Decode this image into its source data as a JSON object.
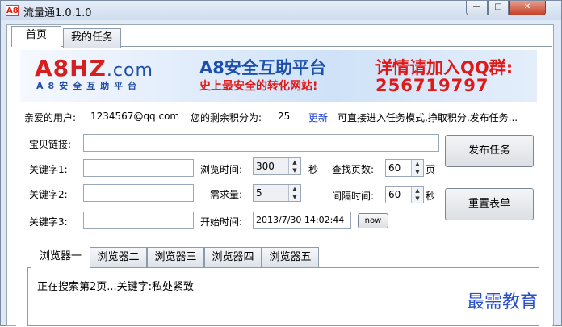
{
  "window": {
    "title": "流量通1.0.1.0",
    "icon": "A8",
    "minimize": "—",
    "maximize": "□",
    "close": "✕"
  },
  "tabs": [
    {
      "label": "首页"
    },
    {
      "label": "我的任务"
    }
  ],
  "banner": {
    "logo": "A8HZ",
    "logo_domain": ".com",
    "logo_sub": "A8安全互助平台",
    "title": "A8安全互助平台",
    "subtitle": "史上最安全的转化网站!",
    "qq_text": "详情请加入QQ群:",
    "qq_number": "256719797"
  },
  "info": {
    "user_label": "亲爱的用户:",
    "user_email": "1234567@qq.com",
    "points_label": "您的剩余积分为:",
    "points_value": "25",
    "update_link": "更新",
    "tip": "可直接进入任务模式,挣取积分,发布任务..."
  },
  "form": {
    "link_label": "宝贝链接:",
    "link_value": "",
    "kw1_label": "关键字1:",
    "kw1_value": "",
    "kw2_label": "关键字2:",
    "kw2_value": "",
    "kw3_label": "关键字3:",
    "kw3_value": "",
    "browse_time_label": "浏览时间:",
    "browse_time_value": "300",
    "browse_time_unit": "秒",
    "demand_label": "需求量:",
    "demand_value": "5",
    "start_time_label": "开始时间:",
    "start_time_value": "2013/7/30 14:02:44",
    "now_button": "now",
    "search_pages_label": "查找页数:",
    "search_pages_value": "60",
    "search_pages_unit": "页",
    "interval_label": "间隔时间:",
    "interval_value": "60",
    "interval_unit": "秒",
    "publish_button": "发布任务",
    "reset_button": "重置表单"
  },
  "browser_tabs": [
    {
      "label": "浏览器一"
    },
    {
      "label": "浏览器二"
    },
    {
      "label": "浏览器三"
    },
    {
      "label": "浏览器四"
    },
    {
      "label": "浏览器五"
    }
  ],
  "status_text": "正在搜索第2页...关键字:私处紧致",
  "watermark": "最需教育",
  "colors": {
    "accent_red": "#e01818",
    "accent_blue": "#1b4fae",
    "link": "#1c3fd0"
  }
}
